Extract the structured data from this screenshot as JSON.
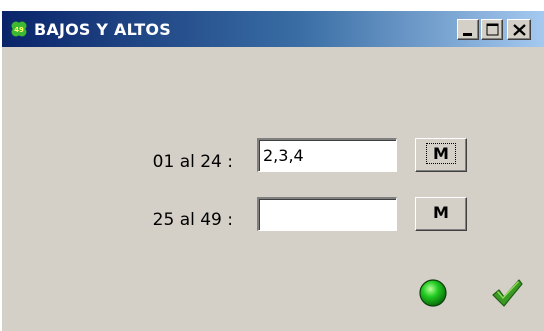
{
  "window": {
    "title": "BAJOS Y ALTOS",
    "icon": "clover-49-icon",
    "controls": {
      "minimize": "minimize-icon",
      "maximize": "maximize-icon",
      "close": "close-icon"
    }
  },
  "rows": [
    {
      "label": "01 al 24 :",
      "value": "2,3,4",
      "button_label": "M"
    },
    {
      "label": "25 al 49 :",
      "value": "",
      "button_label": "M"
    }
  ],
  "footer": {
    "status_icon": "green-circle-icon",
    "ok_icon": "green-check-icon"
  },
  "colors": {
    "window_bg": "#d4d0c8",
    "title_start": "#0a246a",
    "title_end": "#a6caf0",
    "status_green": "#22cc22",
    "check_green": "#2e8b1e"
  }
}
